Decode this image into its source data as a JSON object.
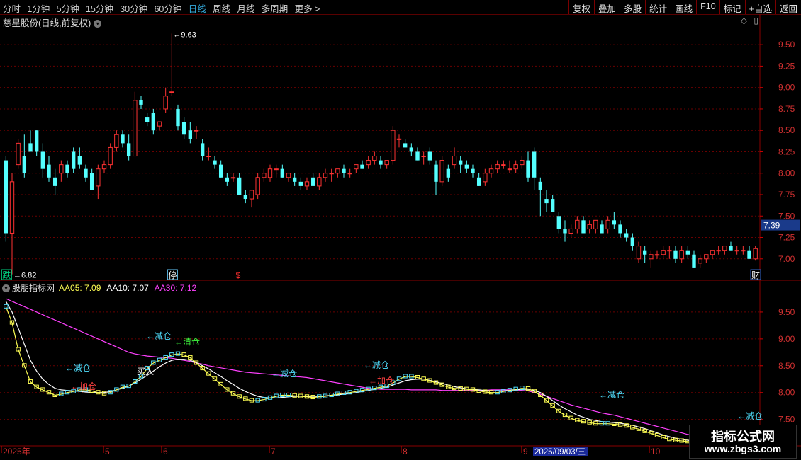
{
  "toolbar": {
    "periods": [
      "分时",
      "1分钟",
      "5分钟",
      "15分钟",
      "30分钟",
      "60分钟",
      "日线",
      "周线",
      "月线",
      "多周期",
      "更多 >"
    ],
    "active_period": "日线",
    "right_buttons": [
      "复权",
      "叠加",
      "多股",
      "统计",
      "画线",
      "F10",
      "标记",
      "+自选",
      "返回"
    ]
  },
  "main_panel": {
    "title": "慈星股份(日线,前复权)",
    "title_icon": "chevron-down-icon",
    "right_icons": [
      "diamond-icon",
      "panel-icon"
    ],
    "price_axis": [
      "9.50",
      "9.25",
      "9.00",
      "8.75",
      "8.50",
      "8.25",
      "8.00",
      "7.75",
      "7.50",
      "7.25",
      "7.00"
    ],
    "current_price": "7.39",
    "high_marker": "9.63",
    "low_marker": "6.82",
    "bottom_marks": [
      {
        "text": "跌",
        "color": "#00d080",
        "bg": "#00d080"
      },
      {
        "text": "停",
        "color": "#ffffff",
        "bg": "#6cf"
      },
      {
        "text": "$",
        "color": "#ff3030"
      },
      {
        "text": "财",
        "color": "#ffffff",
        "bg": "#3366cc"
      }
    ]
  },
  "indicator_panel": {
    "name": "股朋指标网",
    "aa05_label": "AA05: 7.09",
    "aa10_label": "AA10: 7.07",
    "aa30_label": "AA30: 7.12",
    "value_axis": [
      "9.50",
      "9.00",
      "8.50",
      "8.00",
      "7.50"
    ],
    "signals": [
      {
        "text": "←减仓",
        "color": "#50e0ff"
      },
      {
        "text": "←加仓",
        "color": "#ff4040"
      },
      {
        "text": "买入",
        "color": "#ffffff"
      },
      {
        "text": "←减仓",
        "color": "#50e0ff"
      },
      {
        "text": "←清仓",
        "color": "#40ff40"
      },
      {
        "text": "←减仓",
        "color": "#50e0ff"
      },
      {
        "text": "←减仓",
        "color": "#50e0ff"
      },
      {
        "text": "←加仓",
        "color": "#ff4040"
      },
      {
        "text": "←减仓",
        "color": "#50e0ff"
      },
      {
        "text": "←减仓",
        "color": "#50e0ff"
      }
    ]
  },
  "date_axis": {
    "labels": [
      "2025年",
      "5",
      "6",
      "7",
      "8",
      "9",
      "10"
    ],
    "cursor_date": "2025/09/03/三"
  },
  "watermark": {
    "line1": "指标公式网",
    "line2": "www.zbgs3.com"
  },
  "colors": {
    "up": "#ff3232",
    "down": "#54ffff",
    "aa05": "#ffff54",
    "aa10": "#ffffff",
    "aa30": "#ff40ff",
    "grid": "#6a0000"
  },
  "chart_data": {
    "type": "candlestick",
    "price_ylim": [
      6.8,
      9.65
    ],
    "indicator_ylim": [
      7.1,
      10.0
    ],
    "candles": [
      [
        8.15,
        8.2,
        7.2,
        7.3
      ],
      [
        7.3,
        8.0,
        6.82,
        7.9
      ],
      [
        8.1,
        8.4,
        8.05,
        8.35
      ],
      [
        8.2,
        8.45,
        7.95,
        8.0
      ],
      [
        8.35,
        8.5,
        8.25,
        8.25
      ],
      [
        8.5,
        8.5,
        8.2,
        8.25
      ],
      [
        8.25,
        8.35,
        7.95,
        8.05
      ],
      [
        8.1,
        8.2,
        7.9,
        7.95
      ],
      [
        7.95,
        8.05,
        7.75,
        7.85
      ],
      [
        8.0,
        8.15,
        7.9,
        8.1
      ],
      [
        8.1,
        8.15,
        7.95,
        8.0
      ],
      [
        8.25,
        8.3,
        8.0,
        8.05
      ],
      [
        8.2,
        8.3,
        8.05,
        8.1
      ],
      [
        8.05,
        8.1,
        7.9,
        7.95
      ],
      [
        8.0,
        8.05,
        7.8,
        7.8
      ],
      [
        7.85,
        8.1,
        7.7,
        8.05
      ],
      [
        8.05,
        8.15,
        8.0,
        8.1
      ],
      [
        8.1,
        8.35,
        8.05,
        8.3
      ],
      [
        8.3,
        8.5,
        8.25,
        8.45
      ],
      [
        8.45,
        8.5,
        8.3,
        8.35
      ],
      [
        8.35,
        8.45,
        8.15,
        8.2
      ],
      [
        8.2,
        8.95,
        8.2,
        8.85
      ],
      [
        8.85,
        8.9,
        8.75,
        8.8
      ],
      [
        8.65,
        8.7,
        8.55,
        8.6
      ],
      [
        8.7,
        8.75,
        8.45,
        8.5
      ],
      [
        8.55,
        8.6,
        8.5,
        8.6
      ],
      [
        8.75,
        9.0,
        8.7,
        8.9
      ],
      [
        8.95,
        9.63,
        8.9,
        8.95
      ],
      [
        8.75,
        8.8,
        8.5,
        8.55
      ],
      [
        8.6,
        8.65,
        8.4,
        8.45
      ],
      [
        8.5,
        8.6,
        8.35,
        8.4
      ],
      [
        8.5,
        8.55,
        8.4,
        8.5
      ],
      [
        8.35,
        8.4,
        8.15,
        8.2
      ],
      [
        8.2,
        8.3,
        8.15,
        8.2
      ],
      [
        8.15,
        8.2,
        8.05,
        8.1
      ],
      [
        8.1,
        8.15,
        7.95,
        7.95
      ],
      [
        7.95,
        8.0,
        7.85,
        7.9
      ],
      [
        7.95,
        8.0,
        7.9,
        7.95
      ],
      [
        7.95,
        8.0,
        7.75,
        7.75
      ],
      [
        7.75,
        7.8,
        7.65,
        7.7
      ],
      [
        7.7,
        7.8,
        7.6,
        7.8
      ],
      [
        7.75,
        8.0,
        7.7,
        7.95
      ],
      [
        7.95,
        8.05,
        7.9,
        8.0
      ],
      [
        7.95,
        8.1,
        7.9,
        8.05
      ],
      [
        8.05,
        8.1,
        7.95,
        8.05
      ],
      [
        8.05,
        8.1,
        7.95,
        7.95
      ],
      [
        7.95,
        8.0,
        7.9,
        8.0
      ],
      [
        7.95,
        8.0,
        7.85,
        7.9
      ],
      [
        7.9,
        7.95,
        7.8,
        7.85
      ],
      [
        7.85,
        7.95,
        7.8,
        7.9
      ],
      [
        7.95,
        8.0,
        7.85,
        7.85
      ],
      [
        7.85,
        8.0,
        7.8,
        7.95
      ],
      [
        7.95,
        8.05,
        7.9,
        8.0
      ],
      [
        8.0,
        8.05,
        7.9,
        8.0
      ],
      [
        8.0,
        8.05,
        7.95,
        8.05
      ],
      [
        8.05,
        8.1,
        7.95,
        8.0
      ],
      [
        8.0,
        8.05,
        7.95,
        8.0
      ],
      [
        8.05,
        8.1,
        8.0,
        8.1
      ],
      [
        8.1,
        8.15,
        8.05,
        8.05
      ],
      [
        8.1,
        8.2,
        8.05,
        8.15
      ],
      [
        8.15,
        8.25,
        8.1,
        8.2
      ],
      [
        8.15,
        8.2,
        8.05,
        8.1
      ],
      [
        8.1,
        8.15,
        8.05,
        8.15
      ],
      [
        8.15,
        8.55,
        8.1,
        8.5
      ],
      [
        8.4,
        8.45,
        8.3,
        8.4
      ],
      [
        8.35,
        8.4,
        8.3,
        8.3
      ],
      [
        8.3,
        8.35,
        8.2,
        8.25
      ],
      [
        8.25,
        8.3,
        8.15,
        8.15
      ],
      [
        8.2,
        8.25,
        8.1,
        8.2
      ],
      [
        8.25,
        8.3,
        8.1,
        8.15
      ],
      [
        8.1,
        8.15,
        7.75,
        7.9
      ],
      [
        7.9,
        8.2,
        7.85,
        8.15
      ],
      [
        8.05,
        8.1,
        7.9,
        7.95
      ],
      [
        8.1,
        8.3,
        8.05,
        8.2
      ],
      [
        8.15,
        8.2,
        8.0,
        8.1
      ],
      [
        8.1,
        8.15,
        8.0,
        8.05
      ],
      [
        8.05,
        8.1,
        7.95,
        8.0
      ],
      [
        7.95,
        8.0,
        7.85,
        7.85
      ],
      [
        7.9,
        8.05,
        7.85,
        8.0
      ],
      [
        8.0,
        8.1,
        7.95,
        8.05
      ],
      [
        8.05,
        8.15,
        8.0,
        8.1
      ],
      [
        8.1,
        8.15,
        8.05,
        8.1
      ],
      [
        8.05,
        8.15,
        8.0,
        8.05
      ],
      [
        8.05,
        8.15,
        8.0,
        8.1
      ],
      [
        8.1,
        8.2,
        8.05,
        8.15
      ],
      [
        8.15,
        8.25,
        7.9,
        7.95
      ],
      [
        8.25,
        8.3,
        7.8,
        7.95
      ],
      [
        7.9,
        7.95,
        7.5,
        7.8
      ],
      [
        7.7,
        7.8,
        7.55,
        7.65
      ],
      [
        7.7,
        7.75,
        7.55,
        7.55
      ],
      [
        7.5,
        7.55,
        7.3,
        7.35
      ],
      [
        7.35,
        7.45,
        7.2,
        7.3
      ],
      [
        7.3,
        7.4,
        7.25,
        7.35
      ],
      [
        7.35,
        7.5,
        7.3,
        7.45
      ],
      [
        7.45,
        7.5,
        7.3,
        7.3
      ],
      [
        7.35,
        7.45,
        7.3,
        7.4
      ],
      [
        7.35,
        7.45,
        7.3,
        7.45
      ],
      [
        7.4,
        7.45,
        7.3,
        7.3
      ],
      [
        7.35,
        7.5,
        7.3,
        7.45
      ],
      [
        7.45,
        7.55,
        7.35,
        7.4
      ],
      [
        7.4,
        7.45,
        7.25,
        7.3
      ],
      [
        7.3,
        7.35,
        7.2,
        7.25
      ],
      [
        7.25,
        7.3,
        7.1,
        7.15
      ],
      [
        7.0,
        7.2,
        6.95,
        7.15
      ],
      [
        7.1,
        7.15,
        6.95,
        7.05
      ],
      [
        7.0,
        7.1,
        6.9,
        7.05
      ],
      [
        7.05,
        7.1,
        7.0,
        7.05
      ],
      [
        7.05,
        7.15,
        7.0,
        7.1
      ],
      [
        7.1,
        7.15,
        7.0,
        7.1
      ],
      [
        7.1,
        7.15,
        6.95,
        7.0
      ],
      [
        7.0,
        7.15,
        6.95,
        7.1
      ],
      [
        7.1,
        7.15,
        7.0,
        7.05
      ],
      [
        7.05,
        7.1,
        6.9,
        6.9
      ],
      [
        6.95,
        7.05,
        6.9,
        7.0
      ],
      [
        7.0,
        7.05,
        6.95,
        7.05
      ],
      [
        7.05,
        7.1,
        7.0,
        7.1
      ],
      [
        7.1,
        7.15,
        7.05,
        7.1
      ],
      [
        7.1,
        7.15,
        7.05,
        7.15
      ],
      [
        7.15,
        7.2,
        7.1,
        7.1
      ],
      [
        7.1,
        7.15,
        7.05,
        7.1
      ],
      [
        7.1,
        7.15,
        7.05,
        7.1
      ],
      [
        7.1,
        7.15,
        7.0,
        7.0
      ],
      [
        7.0,
        7.15,
        6.98,
        7.12
      ]
    ],
    "aa05": [
      9.6,
      9.3,
      8.8,
      8.5,
      8.2,
      8.1,
      8.05,
      8.0,
      7.95,
      7.97,
      8.0,
      8.02,
      8.05,
      8.05,
      8.03,
      8.0,
      7.98,
      8.0,
      8.05,
      8.1,
      8.12,
      8.2,
      8.3,
      8.45,
      8.55,
      8.6,
      8.65,
      8.7,
      8.72,
      8.7,
      8.65,
      8.55,
      8.45,
      8.35,
      8.25,
      8.15,
      8.05,
      7.98,
      7.92,
      7.88,
      7.85,
      7.85,
      7.87,
      7.9,
      7.93,
      7.95,
      7.95,
      7.94,
      7.93,
      7.92,
      7.91,
      7.92,
      7.93,
      7.95,
      7.97,
      7.99,
      8.0,
      8.02,
      8.04,
      8.06,
      8.08,
      8.1,
      8.12,
      8.18,
      8.25,
      8.3,
      8.3,
      8.28,
      8.25,
      8.22,
      8.18,
      8.14,
      8.1,
      8.08,
      8.07,
      8.06,
      8.05,
      8.03,
      8.01,
      8.0,
      8.0,
      8.02,
      8.04,
      8.06,
      8.08,
      8.07,
      8.02,
      7.95,
      7.85,
      7.75,
      7.65,
      7.58,
      7.52,
      7.48,
      7.46,
      7.44,
      7.42,
      7.42,
      7.42,
      7.41,
      7.4,
      7.38,
      7.35,
      7.32,
      7.28,
      7.24,
      7.2,
      7.16,
      7.13,
      7.11,
      7.1,
      7.09,
      7.09,
      7.08,
      7.07,
      7.06,
      7.06,
      7.07,
      7.08,
      7.09,
      7.09,
      7.09,
      7.1,
      7.09
    ],
    "aa10": [
      9.7,
      9.5,
      9.2,
      8.9,
      8.6,
      8.4,
      8.25,
      8.15,
      8.08,
      8.05,
      8.04,
      8.03,
      8.02,
      8.01,
      8.0,
      8.0,
      8.0,
      8.02,
      8.05,
      8.08,
      8.12,
      8.18,
      8.25,
      8.32,
      8.4,
      8.48,
      8.55,
      8.6,
      8.62,
      8.62,
      8.6,
      8.56,
      8.5,
      8.44,
      8.37,
      8.3,
      8.22,
      8.15,
      8.08,
      8.02,
      7.97,
      7.93,
      7.91,
      7.9,
      7.9,
      7.91,
      7.92,
      7.93,
      7.93,
      7.93,
      7.93,
      7.93,
      7.94,
      7.95,
      7.96,
      7.97,
      7.98,
      8.0,
      8.02,
      8.04,
      8.06,
      8.08,
      8.1,
      8.14,
      8.18,
      8.22,
      8.24,
      8.25,
      8.25,
      8.23,
      8.2,
      8.17,
      8.14,
      8.11,
      8.09,
      8.07,
      8.06,
      8.05,
      8.04,
      8.03,
      8.03,
      8.03,
      8.04,
      8.05,
      8.06,
      8.06,
      8.04,
      8.0,
      7.93,
      7.85,
      7.77,
      7.7,
      7.64,
      7.58,
      7.54,
      7.5,
      7.48,
      7.46,
      7.45,
      7.44,
      7.43,
      7.41,
      7.39,
      7.36,
      7.33,
      7.29,
      7.25,
      7.21,
      7.18,
      7.15,
      7.13,
      7.11,
      7.1,
      7.09,
      7.08,
      7.08,
      7.07,
      7.07,
      7.07,
      7.07,
      7.08,
      7.08,
      7.08,
      7.07
    ],
    "aa30": [
      9.75,
      9.7,
      9.65,
      9.6,
      9.55,
      9.5,
      9.45,
      9.4,
      9.35,
      9.3,
      9.25,
      9.2,
      9.15,
      9.1,
      9.05,
      9.0,
      8.95,
      8.9,
      8.85,
      8.8,
      8.75,
      8.72,
      8.7,
      8.68,
      8.67,
      8.66,
      8.65,
      8.64,
      8.62,
      8.6,
      8.58,
      8.55,
      8.53,
      8.5,
      8.48,
      8.46,
      8.44,
      8.42,
      8.4,
      8.38,
      8.37,
      8.36,
      8.35,
      8.34,
      8.33,
      8.32,
      8.31,
      8.3,
      8.29,
      8.28,
      8.26,
      8.24,
      8.22,
      8.2,
      8.18,
      8.16,
      8.14,
      8.12,
      8.1,
      8.08,
      8.07,
      8.06,
      8.06,
      8.06,
      8.06,
      8.06,
      8.05,
      8.05,
      8.05,
      8.05,
      8.05,
      8.04,
      8.04,
      8.04,
      8.04,
      8.04,
      8.04,
      8.04,
      8.04,
      8.05,
      8.05,
      8.05,
      8.05,
      8.05,
      8.04,
      8.03,
      8.0,
      7.97,
      7.93,
      7.89,
      7.85,
      7.81,
      7.77,
      7.74,
      7.71,
      7.68,
      7.65,
      7.62,
      7.6,
      7.58,
      7.55,
      7.52,
      7.49,
      7.46,
      7.43,
      7.4,
      7.37,
      7.34,
      7.31,
      7.28,
      7.25,
      7.22,
      7.2,
      7.18,
      7.16,
      7.15,
      7.14,
      7.13,
      7.13,
      7.12,
      7.12,
      7.12,
      7.12,
      7.12
    ]
  }
}
